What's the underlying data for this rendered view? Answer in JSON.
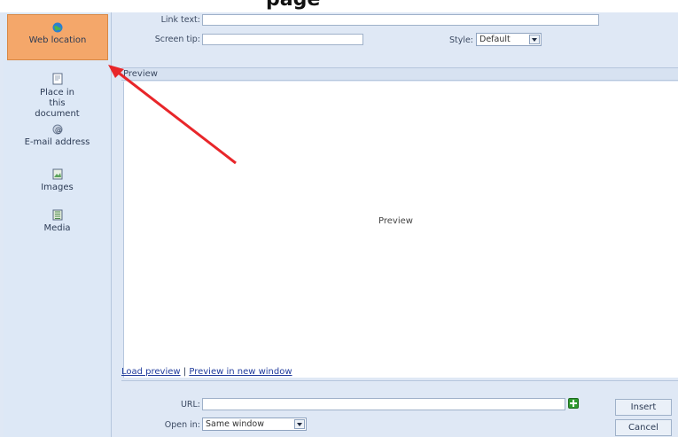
{
  "page_heading_fragment": "page",
  "sidebar": {
    "items": [
      {
        "label": "Web location",
        "icon": "globe-icon",
        "active": true
      },
      {
        "label": "Place in this document",
        "icon": "document-icon"
      },
      {
        "label": "E-mail address",
        "icon": "email-icon"
      },
      {
        "label": "Images",
        "icon": "image-icon"
      },
      {
        "label": "Media",
        "icon": "media-icon"
      }
    ]
  },
  "form": {
    "link_text_label": "Link text:",
    "link_text_value": "",
    "screen_tip_label": "Screen tip:",
    "screen_tip_value": "",
    "style_label": "Style:",
    "style_value": "Default"
  },
  "preview": {
    "header": "Preview",
    "placeholder": "Preview",
    "load_link": "Load preview",
    "separator": "|",
    "new_window_link": "Preview in new window"
  },
  "bottom": {
    "url_label": "URL:",
    "url_value": "",
    "open_in_label": "Open in:",
    "open_in_value": "Same window",
    "insert_label": "Insert",
    "cancel_label": "Cancel"
  },
  "colors": {
    "active_tab": "#f4a76a",
    "annotation_arrow": "#e8262a",
    "dialog_bg": "#dfe8f5"
  }
}
